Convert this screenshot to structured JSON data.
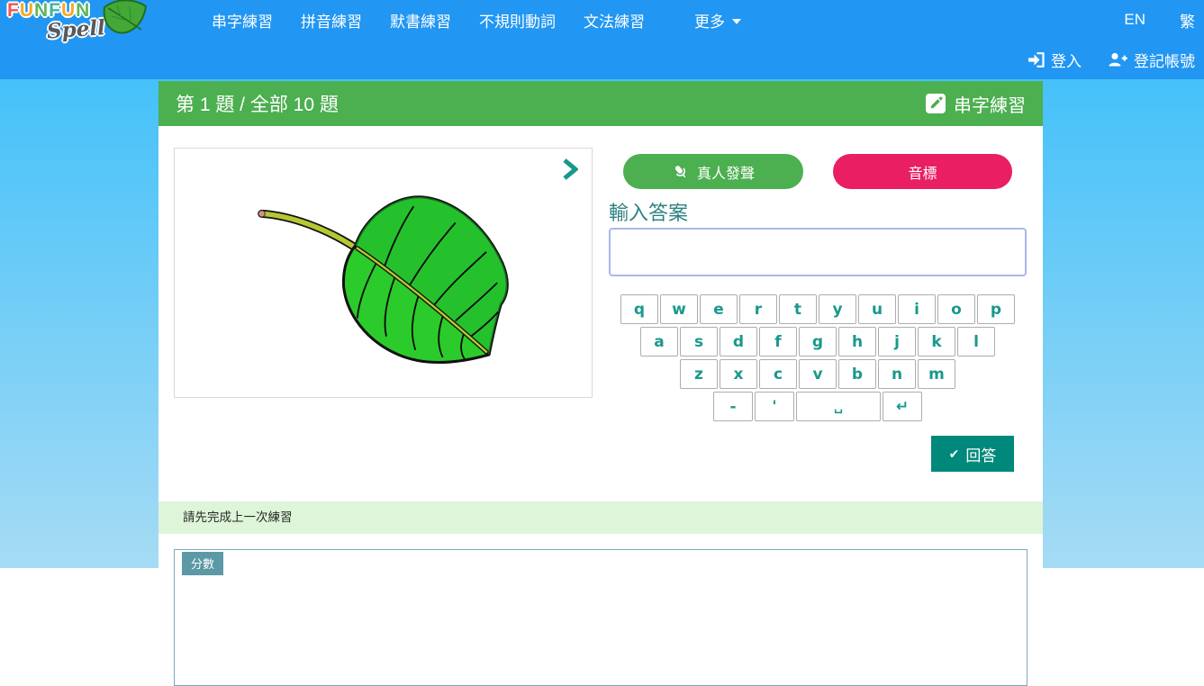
{
  "logo": {
    "word": [
      {
        "ch": "F",
        "color": "#f4574d"
      },
      {
        "ch": "U",
        "color": "#f9a825"
      },
      {
        "ch": "N",
        "color": "#5cb85c"
      },
      {
        "ch": "F",
        "color": "#3eb7a0"
      },
      {
        "ch": "U",
        "color": "#f9a825"
      },
      {
        "ch": "N",
        "color": "#5cb85c"
      }
    ],
    "sub": "Spell"
  },
  "navbar": {
    "items": [
      "串字練習",
      "拼音練習",
      "默書練習",
      "不規則動詞",
      "文法練習"
    ],
    "more_label": "更多",
    "lang_en": "EN",
    "lang_zh": "繁",
    "login_label": "登入",
    "register_label": "登記帳號"
  },
  "header": {
    "progress": "第 1 題 / 全部 10 題",
    "mode_label": "串字練習"
  },
  "actions": {
    "voice_label": "真人發聲",
    "phonetic_label": "音標"
  },
  "answer": {
    "label": "輸入答案",
    "value": "",
    "placeholder": ""
  },
  "keyboard": {
    "rows": [
      [
        "q",
        "w",
        "e",
        "r",
        "t",
        "y",
        "u",
        "i",
        "o",
        "p"
      ],
      [
        "a",
        "s",
        "d",
        "f",
        "g",
        "h",
        "j",
        "k",
        "l"
      ],
      [
        "z",
        "x",
        "c",
        "v",
        "b",
        "n",
        "m"
      ],
      [
        "-",
        "'",
        "␣",
        "↵"
      ]
    ]
  },
  "submit": {
    "check": "✔",
    "label": "回答"
  },
  "notice": {
    "text": "請先完成上一次練習"
  },
  "score": {
    "tab_label": "分數"
  },
  "icons": {
    "logo_leaf": "leaf-icon",
    "mode": "pencil-icon",
    "voice": "microphone-icon",
    "next_image": "chevron-right-icon",
    "more": "chevron-down-icon",
    "login": "sign-in-icon",
    "register": "user-plus-icon",
    "submit": "check-icon"
  },
  "colors": {
    "navbar": "#2196f3",
    "background_top": "#45c1f9",
    "background_bottom": "#a6dbf4",
    "header_green": "#4caf50",
    "voice_button": "#4caf50",
    "phonetic_button": "#e91e63",
    "answer_button": "#00897b",
    "key_letter": "#18998b",
    "answer_label": "#2e8282",
    "input_border": "#a9b8ea",
    "notice_bg": "#def5da",
    "score_tab": "#5b99a6"
  }
}
